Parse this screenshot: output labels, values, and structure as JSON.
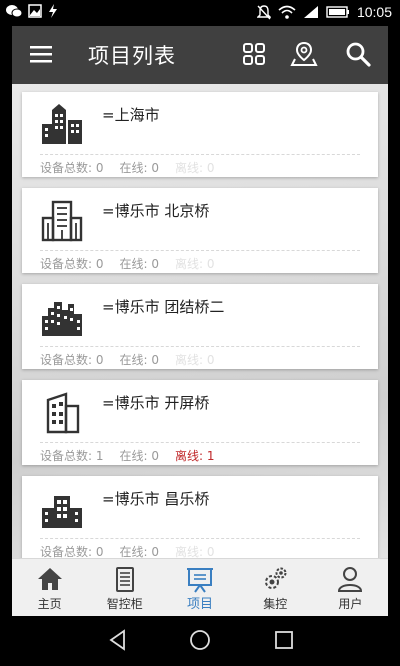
{
  "status_bar": {
    "time": "10:05"
  },
  "app_bar": {
    "title": "项目列表"
  },
  "projects": [
    {
      "name": "=上海市",
      "total_label": "设备总数:",
      "total": "0",
      "online_label": "在线:",
      "online": "0",
      "offline_label": "离线:",
      "offline": "0",
      "offline_alert": false
    },
    {
      "name": "=博乐市 北京桥",
      "total_label": "设备总数:",
      "total": "0",
      "online_label": "在线:",
      "online": "0",
      "offline_label": "离线:",
      "offline": "0",
      "offline_alert": false
    },
    {
      "name": "=博乐市 团结桥二",
      "total_label": "设备总数:",
      "total": "0",
      "online_label": "在线:",
      "online": "0",
      "offline_label": "离线:",
      "offline": "0",
      "offline_alert": false
    },
    {
      "name": "=博乐市 开屏桥",
      "total_label": "设备总数:",
      "total": "1",
      "online_label": "在线:",
      "online": "0",
      "offline_label": "离线:",
      "offline": "1",
      "offline_alert": true
    },
    {
      "name": "=博乐市 昌乐桥",
      "total_label": "设备总数:",
      "total": "0",
      "online_label": "在线:",
      "online": "0",
      "offline_label": "离线:",
      "offline": "0",
      "offline_alert": false
    }
  ],
  "tabs": [
    {
      "label": "主页",
      "icon": "home-icon"
    },
    {
      "label": "智控柜",
      "icon": "cabinet-icon"
    },
    {
      "label": "项目",
      "icon": "project-icon",
      "active": true
    },
    {
      "label": "集控",
      "icon": "gears-icon"
    },
    {
      "label": "用户",
      "icon": "user-icon"
    }
  ],
  "colors": {
    "app_bar": "#404040",
    "active_tab": "#3a7fc1",
    "offline_alert": "#c0282a"
  }
}
